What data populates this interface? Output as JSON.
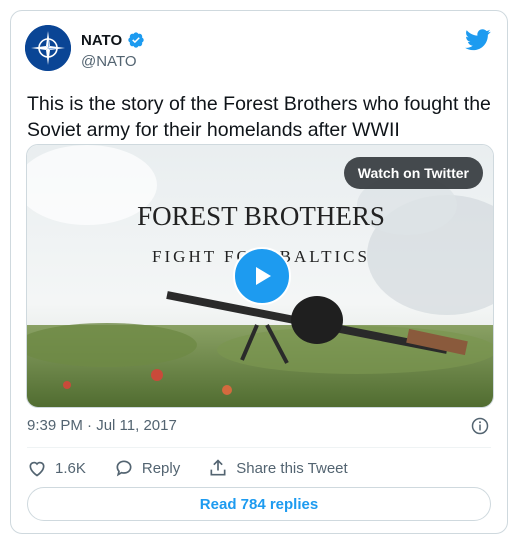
{
  "account": {
    "name": "NATO",
    "handle": "@NATO",
    "verified": true
  },
  "tweet": {
    "text": "This is the story of the Forest Brothers who fought the Soviet army for their homelands after WWII"
  },
  "media": {
    "watch_label": "Watch on Twitter",
    "title_line1": "FOREST  BROTHERS",
    "title_line2": "FIGHT FO    E BALTICS"
  },
  "meta": {
    "timestamp": "9:39 PM · Jul 11, 2017"
  },
  "actions": {
    "likes": "1.6K",
    "reply_label": "Reply",
    "share_label": "Share this Tweet"
  },
  "replies_label": "Read 784 replies",
  "colors": {
    "accent": "#1d9bf0",
    "text": "#0f1419",
    "muted": "#536471",
    "border": "#cfd9de"
  },
  "icons": [
    "nato-logo-avatar",
    "verified-badge-icon",
    "twitter-bird-icon",
    "play-icon",
    "info-icon",
    "heart-icon",
    "reply-icon",
    "share-icon"
  ]
}
